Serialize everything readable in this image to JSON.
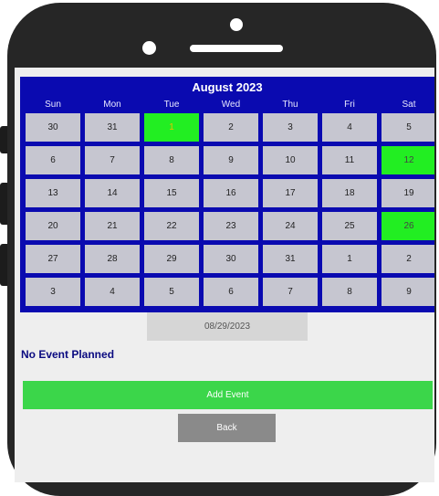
{
  "calendar": {
    "title": "August 2023",
    "weekdays": [
      "Sun",
      "Mon",
      "Tue",
      "Wed",
      "Thu",
      "Fri",
      "Sat"
    ],
    "weeks": [
      [
        "30",
        "31",
        "1",
        "2",
        "3",
        "4",
        "5"
      ],
      [
        "6",
        "7",
        "8",
        "9",
        "10",
        "11",
        "12"
      ],
      [
        "13",
        "14",
        "15",
        "16",
        "17",
        "18",
        "19"
      ],
      [
        "20",
        "21",
        "22",
        "23",
        "24",
        "25",
        "26"
      ],
      [
        "27",
        "28",
        "29",
        "30",
        "31",
        "1",
        "2"
      ],
      [
        "3",
        "4",
        "5",
        "6",
        "7",
        "8",
        "9"
      ]
    ],
    "highlighted_days": [
      "1",
      "12",
      "26"
    ],
    "today": "1",
    "header_color": "#0a0ab0",
    "event_color": "#22ee22"
  },
  "selected_date": "08/29/2023",
  "event_status": "No Event Planned",
  "buttons": {
    "add_event": "Add Event",
    "back": "Back",
    "add_color": "#3bd64a",
    "back_color": "#8a8a8a"
  }
}
